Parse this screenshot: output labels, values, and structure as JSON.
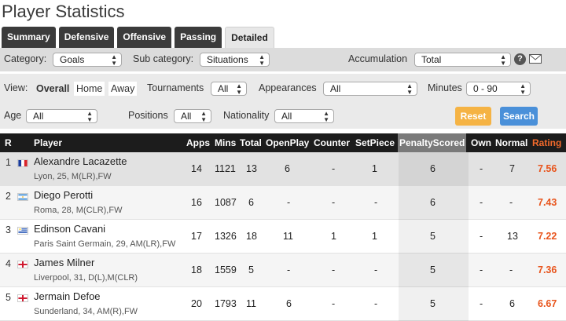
{
  "page": {
    "title": "Player Statistics"
  },
  "tabs": [
    "Summary",
    "Defensive",
    "Offensive",
    "Passing",
    "Detailed"
  ],
  "active_tab": "Detailed",
  "filters": {
    "category_label": "Category:",
    "category_value": "Goals",
    "subcategory_label": "Sub category:",
    "subcategory_value": "Situations",
    "accumulation_label": "Accumulation",
    "accumulation_value": "Total",
    "view_label": "View:",
    "view_options": [
      "Overall",
      "Home",
      "Away"
    ],
    "view_selected": "Overall",
    "tournaments_label": "Tournaments",
    "tournaments_value": "All",
    "appearances_label": "Appearances",
    "appearances_value": "All",
    "minutes_label": "Minutes",
    "minutes_value": "0 - 90",
    "age_label": "Age",
    "age_value": "All",
    "positions_label": "Positions",
    "positions_value": "All",
    "nationality_label": "Nationality",
    "nationality_value": "All",
    "reset_label": "Reset",
    "search_label": "Search",
    "help_icon": "?"
  },
  "table": {
    "headers": [
      "R",
      "Player",
      "Apps",
      "Mins",
      "Total",
      "OpenPlay",
      "Counter",
      "SetPiece",
      "PenaltyScored",
      "Own",
      "Normal",
      "Rating"
    ],
    "rows": [
      {
        "rank": "1",
        "flag": "france",
        "name": "Alexandre Lacazette",
        "info": "Lyon, 25, M(LR),FW",
        "apps": "14",
        "mins": "1121",
        "total": "13",
        "openplay": "6",
        "counter": "-",
        "setpiece": "1",
        "penalty": "6",
        "own": "-",
        "normal": "7",
        "rating": "7.56"
      },
      {
        "rank": "2",
        "flag": "argentina",
        "name": "Diego Perotti",
        "info": "Roma, 28, M(CLR),FW",
        "apps": "16",
        "mins": "1087",
        "total": "6",
        "openplay": "-",
        "counter": "-",
        "setpiece": "-",
        "penalty": "6",
        "own": "-",
        "normal": "-",
        "rating": "7.43"
      },
      {
        "rank": "3",
        "flag": "uruguay",
        "name": "Edinson Cavani",
        "info": "Paris Saint Germain, 29, AM(LR),FW",
        "apps": "17",
        "mins": "1326",
        "total": "18",
        "openplay": "11",
        "counter": "1",
        "setpiece": "1",
        "penalty": "5",
        "own": "-",
        "normal": "13",
        "rating": "7.22"
      },
      {
        "rank": "4",
        "flag": "england",
        "name": "James Milner",
        "info": "Liverpool, 31, D(L),M(CLR)",
        "apps": "18",
        "mins": "1559",
        "total": "5",
        "openplay": "-",
        "counter": "-",
        "setpiece": "-",
        "penalty": "5",
        "own": "-",
        "normal": "-",
        "rating": "7.36"
      },
      {
        "rank": "5",
        "flag": "england",
        "name": "Jermain Defoe",
        "info": "Sunderland, 34, AM(R),FW",
        "apps": "20",
        "mins": "1793",
        "total": "11",
        "openplay": "6",
        "counter": "-",
        "setpiece": "-",
        "penalty": "5",
        "own": "-",
        "normal": "6",
        "rating": "6.67"
      }
    ]
  },
  "colors": {
    "header_bg": "#1c1c1c",
    "rating": "#e8541c",
    "reset": "#f5b344",
    "search": "#4a90d9",
    "penalty_header": "#7a7a7a"
  }
}
